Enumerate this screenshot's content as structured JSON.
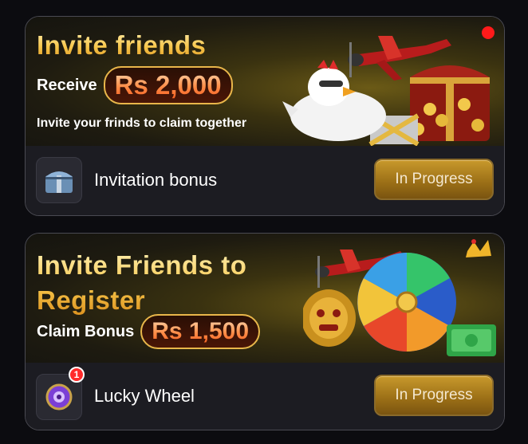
{
  "cards": [
    {
      "title": "Invite friends",
      "receive_label": "Receive",
      "amount": "Rs 2,000",
      "subtext": "Invite your frinds to claim together",
      "reward_label": "Invitation bonus",
      "reward_icon": "treasure-chest-icon",
      "button_label": "In Progress",
      "has_notification_dot": true
    },
    {
      "title": "Invite Friends to Register",
      "receive_label": "Claim Bonus",
      "amount": "Rs 1,500",
      "reward_label": "Lucky Wheel",
      "reward_icon": "lucky-wheel-icon",
      "badge_count": "1",
      "button_label": "In Progress"
    }
  ],
  "colors": {
    "title_gold": "#f7c64a",
    "amount_orange": "#ff8f4a",
    "button_gold": "#b8871f",
    "notification_red": "#ff1a1a"
  }
}
